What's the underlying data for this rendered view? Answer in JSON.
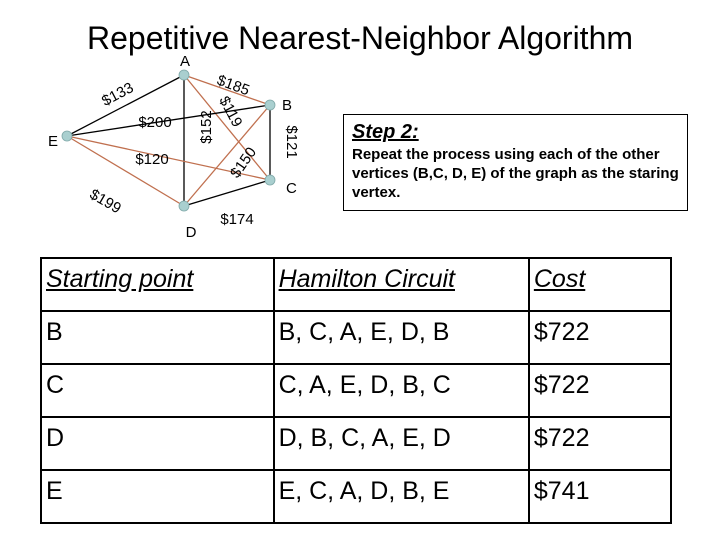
{
  "title": "Repetitive Nearest-Neighbor Algorithm",
  "graph": {
    "vertices": [
      {
        "id": "A",
        "label": "A"
      },
      {
        "id": "B",
        "label": "B"
      },
      {
        "id": "C",
        "label": "C"
      },
      {
        "id": "D",
        "label": "D"
      },
      {
        "id": "E",
        "label": "E"
      }
    ],
    "edges": [
      {
        "from": "A",
        "to": "E",
        "weight": "$133",
        "color": "#000000"
      },
      {
        "from": "A",
        "to": "B",
        "weight": "$185",
        "color": "#c0704f"
      },
      {
        "from": "A",
        "to": "D",
        "weight": "$152",
        "color": "#000000"
      },
      {
        "from": "A",
        "to": "C",
        "weight": "$119",
        "color": "#c0704f"
      },
      {
        "from": "E",
        "to": "B",
        "weight": "$200",
        "color": "#000000"
      },
      {
        "from": "E",
        "to": "C",
        "weight": "$120",
        "color": "#c0704f"
      },
      {
        "from": "E",
        "to": "D",
        "weight": "$199",
        "color": "#c0704f"
      },
      {
        "from": "B",
        "to": "C",
        "weight": "$121",
        "color": "#000000"
      },
      {
        "from": "B",
        "to": "D",
        "weight": "$150",
        "color": "#c0704f"
      },
      {
        "from": "C",
        "to": "D",
        "weight": "$174",
        "color": "#000000"
      }
    ],
    "vertex_fill": "#a9cfcf"
  },
  "step": {
    "title": "Step 2:",
    "text": "Repeat the process using each of the other vertices (B,C, D, E) of the graph as the staring vertex."
  },
  "table": {
    "headers": [
      "Starting point",
      "Hamilton Circuit",
      "Cost"
    ],
    "rows": [
      [
        "B",
        "B, C, A, E, D, B",
        "$722"
      ],
      [
        "C",
        "C, A, E, D, B, C",
        "$722"
      ],
      [
        "D",
        "D, B, C, A, E, D",
        "$722"
      ],
      [
        "E",
        "E, C, A, D, B, E",
        "$741"
      ]
    ]
  }
}
